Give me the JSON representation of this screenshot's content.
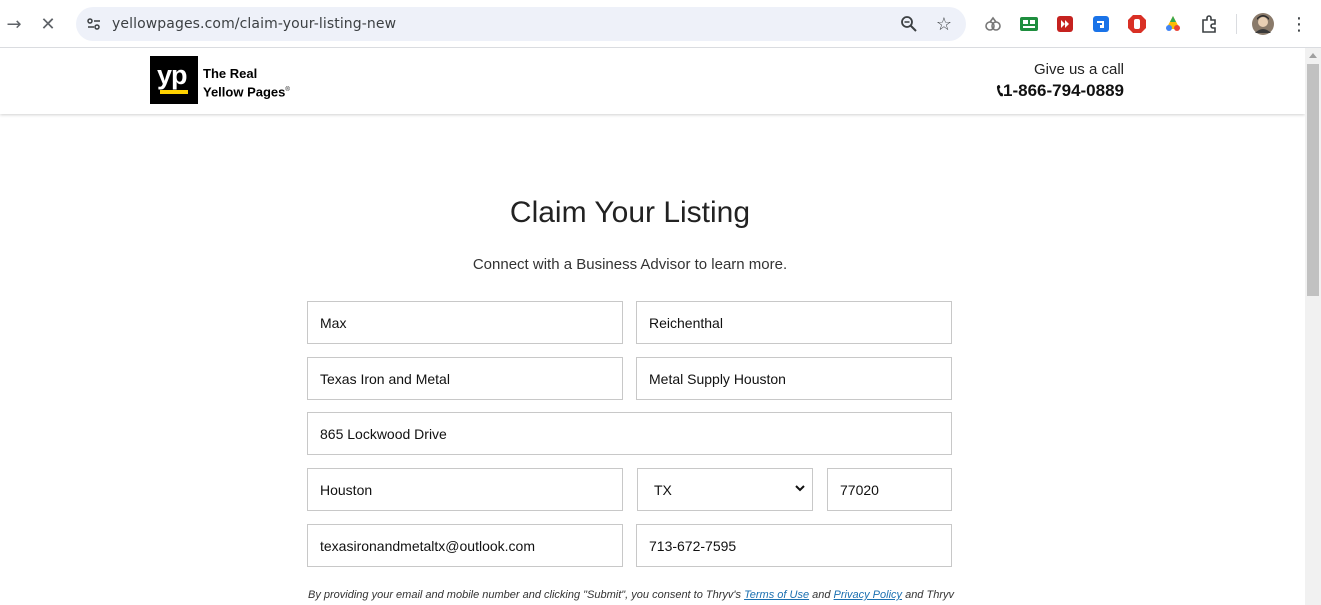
{
  "browser": {
    "url": "yellowpages.com/claim-your-listing-new"
  },
  "header": {
    "logo_mark": "yp",
    "logo_line1": "The Real",
    "logo_line2": "Yellow Pages",
    "logo_reg": "®",
    "call_label": "Give us a call",
    "phone": "1-866-794-0889"
  },
  "main": {
    "title": "Claim Your Listing",
    "subtitle": "Connect with a Business Advisor to learn more."
  },
  "form": {
    "first_name": "Max",
    "last_name": "Reichenthal",
    "business_name": "Texas Iron and Metal",
    "category": "Metal Supply Houston",
    "address": "865 Lockwood Drive",
    "city": "Houston",
    "state": "TX",
    "zip": "77020",
    "email": "texasironandmetaltx@outlook.com",
    "phone": "713-672-7595"
  },
  "consent": {
    "text_before": "By providing your email and mobile number and clicking \"Submit\", you consent to Thryv's ",
    "terms_link": "Terms of Use",
    "and": " and ",
    "privacy_link": "Privacy Policy",
    "text_after": " and Thryv"
  },
  "colors": {
    "brand_yellow": "#ffd200",
    "link": "#1a6fb0"
  }
}
